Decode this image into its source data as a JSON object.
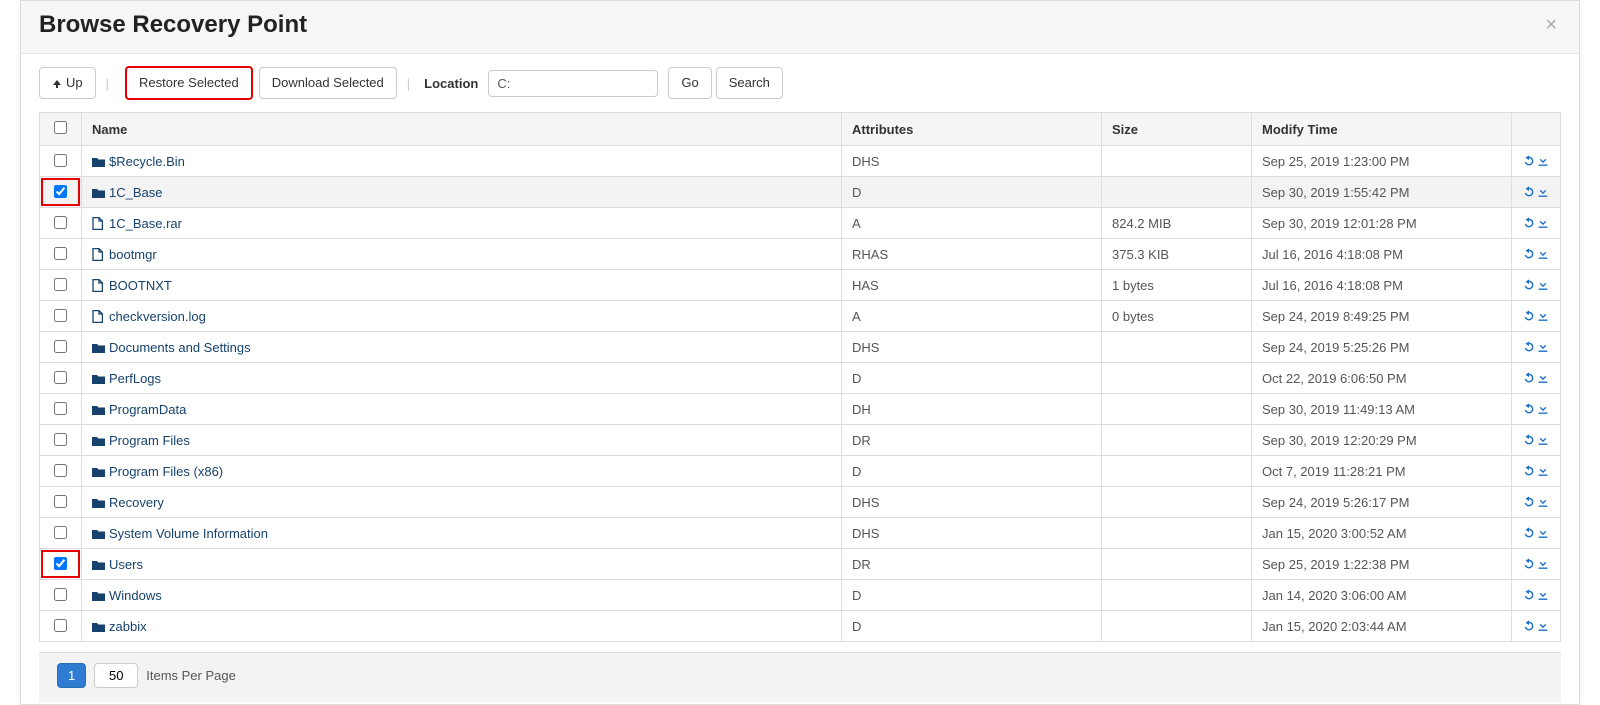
{
  "header": {
    "title": "Browse Recovery Point",
    "close": "×"
  },
  "toolbar": {
    "up_label": "Up",
    "restore_label": "Restore Selected",
    "download_label": "Download Selected",
    "location_label": "Location",
    "location_value": "C:",
    "go_label": "Go",
    "search_label": "Search"
  },
  "table": {
    "headers": {
      "name": "Name",
      "attributes": "Attributes",
      "size": "Size",
      "modify_time": "Modify Time"
    },
    "rows": [
      {
        "checked": false,
        "highlight_chk": false,
        "icon": "folder",
        "name": "$Recycle.Bin",
        "attributes": "DHS",
        "size": "",
        "modify_time": "Sep 25, 2019 1:23:00 PM"
      },
      {
        "checked": true,
        "highlight_chk": true,
        "icon": "folder",
        "name": "1C_Base",
        "attributes": "D",
        "size": "",
        "modify_time": "Sep 30, 2019 1:55:42 PM",
        "selected": true
      },
      {
        "checked": false,
        "highlight_chk": false,
        "icon": "file",
        "name": "1C_Base.rar",
        "attributes": "A",
        "size": "824.2 MIB",
        "modify_time": "Sep 30, 2019 12:01:28 PM"
      },
      {
        "checked": false,
        "highlight_chk": false,
        "icon": "file",
        "name": "bootmgr",
        "attributes": "RHAS",
        "size": "375.3 KIB",
        "modify_time": "Jul 16, 2016 4:18:08 PM"
      },
      {
        "checked": false,
        "highlight_chk": false,
        "icon": "file",
        "name": "BOOTNXT",
        "attributes": "HAS",
        "size": "1 bytes",
        "modify_time": "Jul 16, 2016 4:18:08 PM"
      },
      {
        "checked": false,
        "highlight_chk": false,
        "icon": "file",
        "name": "checkversion.log",
        "attributes": "A",
        "size": "0 bytes",
        "modify_time": "Sep 24, 2019 8:49:25 PM"
      },
      {
        "checked": false,
        "highlight_chk": false,
        "icon": "folder",
        "name": "Documents and Settings",
        "attributes": "DHS",
        "size": "",
        "modify_time": "Sep 24, 2019 5:25:26 PM"
      },
      {
        "checked": false,
        "highlight_chk": false,
        "icon": "folder",
        "name": "PerfLogs",
        "attributes": "D",
        "size": "",
        "modify_time": "Oct 22, 2019 6:06:50 PM"
      },
      {
        "checked": false,
        "highlight_chk": false,
        "icon": "folder",
        "name": "ProgramData",
        "attributes": "DH",
        "size": "",
        "modify_time": "Sep 30, 2019 11:49:13 AM"
      },
      {
        "checked": false,
        "highlight_chk": false,
        "icon": "folder",
        "name": "Program Files",
        "attributes": "DR",
        "size": "",
        "modify_time": "Sep 30, 2019 12:20:29 PM"
      },
      {
        "checked": false,
        "highlight_chk": false,
        "icon": "folder",
        "name": "Program Files (x86)",
        "attributes": "D",
        "size": "",
        "modify_time": "Oct 7, 2019 11:28:21 PM"
      },
      {
        "checked": false,
        "highlight_chk": false,
        "icon": "folder",
        "name": "Recovery",
        "attributes": "DHS",
        "size": "",
        "modify_time": "Sep 24, 2019 5:26:17 PM"
      },
      {
        "checked": false,
        "highlight_chk": false,
        "icon": "folder",
        "name": "System Volume Information",
        "attributes": "DHS",
        "size": "",
        "modify_time": "Jan 15, 2020 3:00:52 AM"
      },
      {
        "checked": true,
        "highlight_chk": true,
        "icon": "folder",
        "name": "Users",
        "attributes": "DR",
        "size": "",
        "modify_time": "Sep 25, 2019 1:22:38 PM"
      },
      {
        "checked": false,
        "highlight_chk": false,
        "icon": "folder",
        "name": "Windows",
        "attributes": "D",
        "size": "",
        "modify_time": "Jan 14, 2020 3:06:00 AM"
      },
      {
        "checked": false,
        "highlight_chk": false,
        "icon": "folder",
        "name": "zabbix",
        "attributes": "D",
        "size": "",
        "modify_time": "Jan 15, 2020 2:03:44 AM"
      }
    ]
  },
  "footer": {
    "page": "1",
    "items_per_page_value": "50",
    "items_per_page_label": "Items Per Page"
  }
}
